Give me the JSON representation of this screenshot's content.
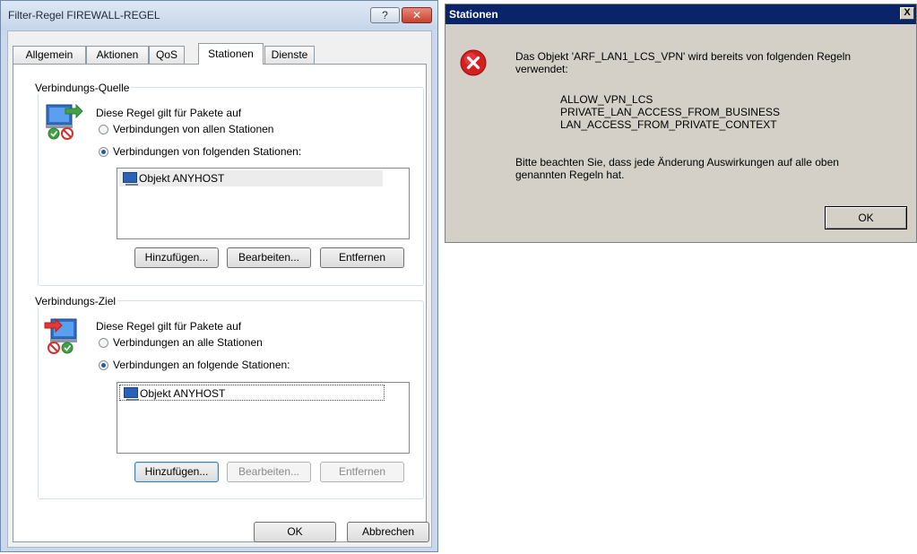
{
  "filter_dialog": {
    "title": "Filter-Regel FIREWALL-REGEL",
    "help_glyph": "?",
    "close_glyph": "✕",
    "tabs": [
      {
        "label": "Allgemein"
      },
      {
        "label": "Aktionen"
      },
      {
        "label": "QoS"
      },
      {
        "label": "Stationen",
        "active": true
      },
      {
        "label": "Dienste"
      }
    ],
    "source": {
      "group_label": "Verbindungs-Quelle",
      "rule_text": "Diese Regel gilt für Pakete auf",
      "radio_all": "Verbindungen von allen Stationen",
      "radio_following": "Verbindungen von folgenden Stationen:",
      "selected": "following",
      "list_items": [
        "Objekt ANYHOST"
      ],
      "add_button": "Hinzufügen...",
      "edit_button": "Bearbeiten...",
      "remove_button": "Entfernen"
    },
    "destination": {
      "group_label": "Verbindungs-Ziel",
      "rule_text": "Diese Regel gilt für Pakete auf",
      "radio_all": "Verbindungen an alle Stationen",
      "radio_following": "Verbindungen an folgende Stationen:",
      "selected": "following",
      "list_items": [
        "Objekt ANYHOST"
      ],
      "add_button": "Hinzufügen...",
      "edit_button": "Bearbeiten...",
      "remove_button": "Entfernen"
    },
    "ok_button": "OK",
    "cancel_button": "Abbrechen"
  },
  "message_dialog": {
    "title": "Stationen",
    "close_glyph": "X",
    "icon": "error-icon",
    "message_line1": "Das Objekt 'ARF_LAN1_LCS_VPN' wird bereits von folgenden Regeln",
    "message_line2": "verwendet:",
    "rules": [
      "ALLOW_VPN_LCS",
      "PRIVATE_LAN_ACCESS_FROM_BUSINESS",
      "LAN_ACCESS_FROM_PRIVATE_CONTEXT"
    ],
    "note_line1": "Bitte beachten Sie, dass jede Änderung Auswirkungen auf alle oben",
    "note_line2": "genannten Regeln hat.",
    "ok_button": "OK"
  }
}
